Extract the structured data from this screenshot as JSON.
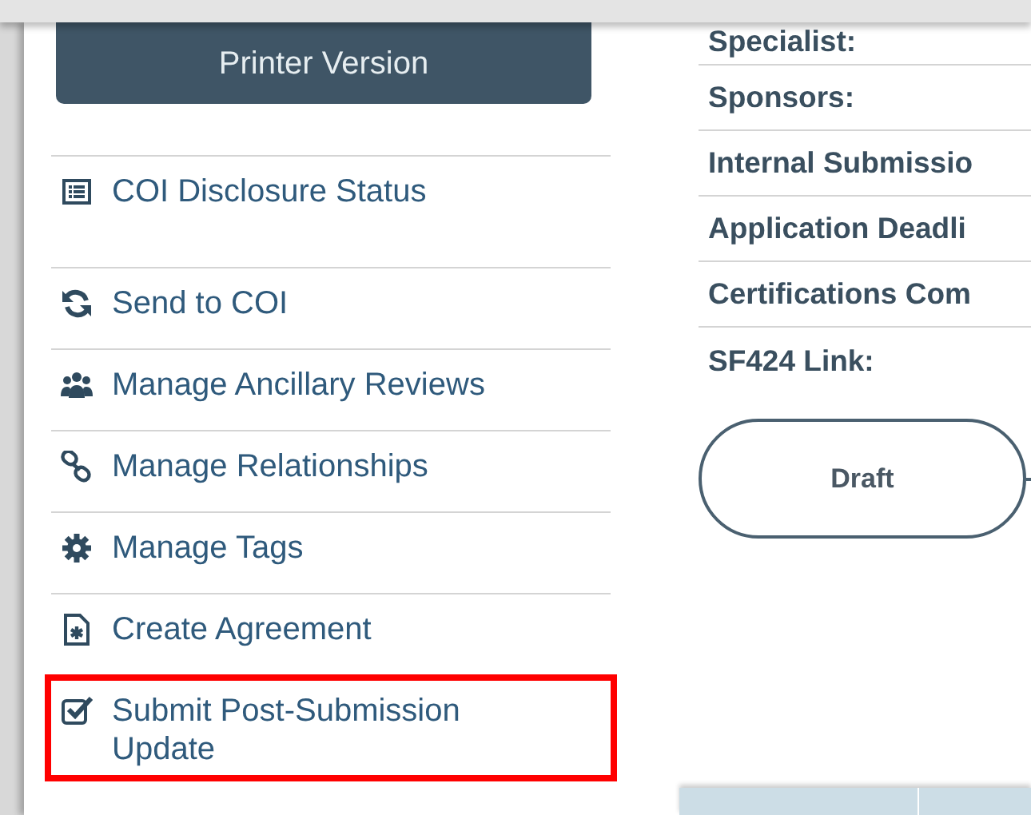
{
  "printer_button": {
    "label": "Printer Version"
  },
  "sidebar": {
    "items": [
      {
        "label": "COI Disclosure Status",
        "highlighted": false
      },
      {
        "label": "Send to COI",
        "highlighted": false
      },
      {
        "label": "Manage Ancillary Reviews",
        "highlighted": false
      },
      {
        "label": "Manage Relationships",
        "highlighted": false
      },
      {
        "label": "Manage Tags",
        "highlighted": false
      },
      {
        "label": "Create Agreement",
        "highlighted": false
      },
      {
        "label": "Submit Post-Submission Update",
        "highlighted": true
      }
    ]
  },
  "fields": [
    {
      "label": "Specialist:"
    },
    {
      "label": "Sponsors:"
    },
    {
      "label": "Internal Submissio"
    },
    {
      "label": "Application Deadli"
    },
    {
      "label": "Certifications Com"
    },
    {
      "label": "SF424 Link:"
    }
  ],
  "workflow": [
    {
      "label": "Draft"
    }
  ]
}
